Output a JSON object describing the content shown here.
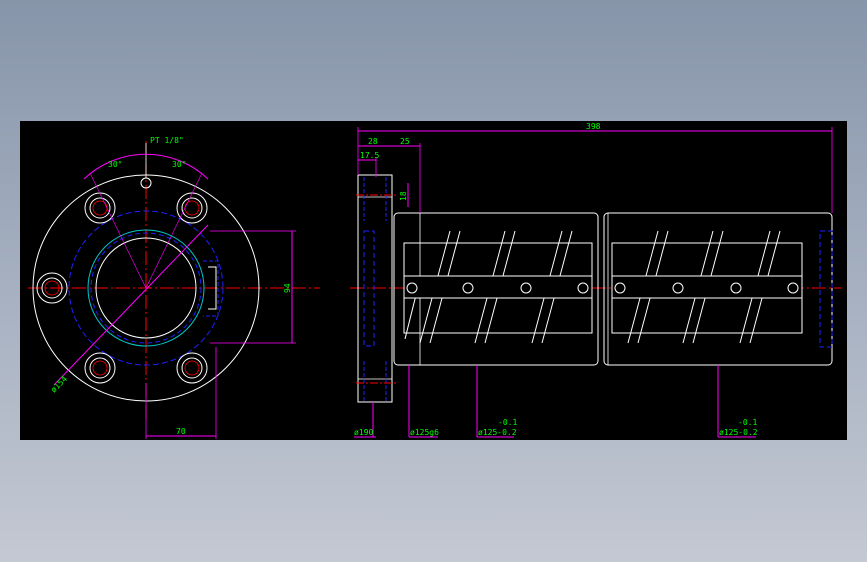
{
  "colors": {
    "canvas_bg": "#000000",
    "outline": "#ffffff",
    "center_line": "#ff0000",
    "hidden_line": "#2020ff",
    "dimension": "#ff00ff",
    "dim_text": "#00ff00",
    "accent_circle": "#00c8c8",
    "thread_line": "#ffff00"
  },
  "front_view": {
    "port_label": "PT 1/8\"",
    "angle_left": "30°",
    "angle_right": "30°",
    "dim_diameter": "ø154",
    "dim_94": "94",
    "dim_70": "70"
  },
  "side_view": {
    "dim_398": "398",
    "dim_28": "28",
    "dim_25": "25",
    "dim_17_5": "17.5",
    "dim_18": "18",
    "callout_190": "ø190",
    "callout_125g6": "ø125g6",
    "tol_upper_1": "-0.1",
    "callout_125_1": "ø125-0.2",
    "tol_upper_2": "-0.1",
    "callout_125_2": "ø125-0.2"
  }
}
